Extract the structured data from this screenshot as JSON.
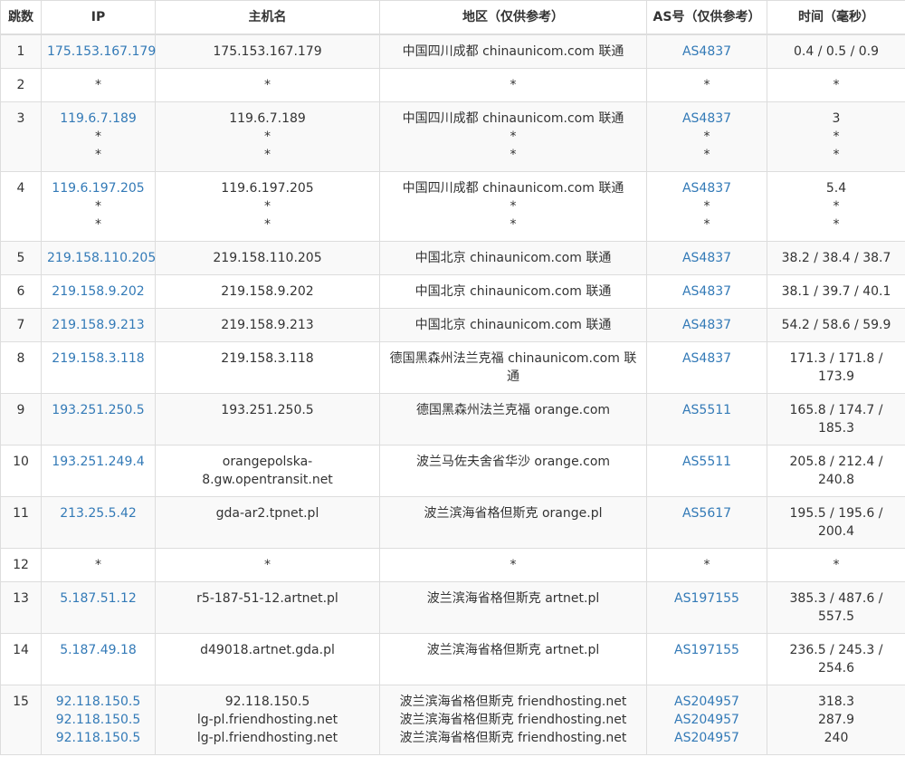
{
  "headers": {
    "hop": "跳数",
    "ip": "IP",
    "host": "主机名",
    "region": "地区（仅供参考）",
    "as": "AS号（仅供参考）",
    "time": "时间（毫秒）"
  },
  "colors": {
    "link": "#337ab7",
    "stripe": "#f9f9f9",
    "border": "#dddddd"
  },
  "rows": [
    {
      "hop": "1",
      "ip": [
        "175.153.167.179"
      ],
      "host": [
        "175.153.167.179"
      ],
      "region": [
        "中国四川成都 chinaunicom.com 联通"
      ],
      "as": [
        "AS4837"
      ],
      "time": [
        "0.4 / 0.5 / 0.9"
      ]
    },
    {
      "hop": "2",
      "ip": [
        "*"
      ],
      "host": [
        "*"
      ],
      "region": [
        "*"
      ],
      "as": [
        "*"
      ],
      "time": [
        "*"
      ]
    },
    {
      "hop": "3",
      "ip": [
        "119.6.7.189",
        "*",
        "*"
      ],
      "host": [
        "119.6.7.189",
        "*",
        "*"
      ],
      "region": [
        "中国四川成都 chinaunicom.com 联通",
        "*",
        "*"
      ],
      "as": [
        "AS4837",
        "*",
        "*"
      ],
      "time": [
        "3",
        "*",
        "*"
      ]
    },
    {
      "hop": "4",
      "ip": [
        "119.6.197.205",
        "*",
        "*"
      ],
      "host": [
        "119.6.197.205",
        "*",
        "*"
      ],
      "region": [
        "中国四川成都 chinaunicom.com 联通",
        "*",
        "*"
      ],
      "as": [
        "AS4837",
        "*",
        "*"
      ],
      "time": [
        "5.4",
        "*",
        "*"
      ]
    },
    {
      "hop": "5",
      "ip": [
        "219.158.110.205"
      ],
      "host": [
        "219.158.110.205"
      ],
      "region": [
        "中国北京 chinaunicom.com 联通"
      ],
      "as": [
        "AS4837"
      ],
      "time": [
        "38.2 / 38.4 / 38.7"
      ]
    },
    {
      "hop": "6",
      "ip": [
        "219.158.9.202"
      ],
      "host": [
        "219.158.9.202"
      ],
      "region": [
        "中国北京 chinaunicom.com 联通"
      ],
      "as": [
        "AS4837"
      ],
      "time": [
        "38.1 / 39.7 / 40.1"
      ]
    },
    {
      "hop": "7",
      "ip": [
        "219.158.9.213"
      ],
      "host": [
        "219.158.9.213"
      ],
      "region": [
        "中国北京 chinaunicom.com 联通"
      ],
      "as": [
        "AS4837"
      ],
      "time": [
        "54.2 / 58.6 / 59.9"
      ]
    },
    {
      "hop": "8",
      "ip": [
        "219.158.3.118"
      ],
      "host": [
        "219.158.3.118"
      ],
      "region": [
        "德国黑森州法兰克福 chinaunicom.com 联通"
      ],
      "as": [
        "AS4837"
      ],
      "time": [
        "171.3 / 171.8 / 173.9"
      ]
    },
    {
      "hop": "9",
      "ip": [
        "193.251.250.5"
      ],
      "host": [
        "193.251.250.5"
      ],
      "region": [
        "德国黑森州法兰克福 orange.com"
      ],
      "as": [
        "AS5511"
      ],
      "time": [
        "165.8 / 174.7 / 185.3"
      ]
    },
    {
      "hop": "10",
      "ip": [
        "193.251.249.4"
      ],
      "host": [
        "orangepolska-8.gw.opentransit.net"
      ],
      "region": [
        "波兰马佐夫舍省华沙 orange.com"
      ],
      "as": [
        "AS5511"
      ],
      "time": [
        "205.8 / 212.4 / 240.8"
      ]
    },
    {
      "hop": "11",
      "ip": [
        "213.25.5.42"
      ],
      "host": [
        "gda-ar2.tpnet.pl"
      ],
      "region": [
        "波兰滨海省格但斯克 orange.pl"
      ],
      "as": [
        "AS5617"
      ],
      "time": [
        "195.5 / 195.6 / 200.4"
      ]
    },
    {
      "hop": "12",
      "ip": [
        "*"
      ],
      "host": [
        "*"
      ],
      "region": [
        "*"
      ],
      "as": [
        "*"
      ],
      "time": [
        "*"
      ]
    },
    {
      "hop": "13",
      "ip": [
        "5.187.51.12"
      ],
      "host": [
        "r5-187-51-12.artnet.pl"
      ],
      "region": [
        "波兰滨海省格但斯克 artnet.pl"
      ],
      "as": [
        "AS197155"
      ],
      "time": [
        "385.3 / 487.6 / 557.5"
      ]
    },
    {
      "hop": "14",
      "ip": [
        "5.187.49.18"
      ],
      "host": [
        "d49018.artnet.gda.pl"
      ],
      "region": [
        "波兰滨海省格但斯克 artnet.pl"
      ],
      "as": [
        "AS197155"
      ],
      "time": [
        "236.5 / 245.3 / 254.6"
      ]
    },
    {
      "hop": "15",
      "ip": [
        "92.118.150.5",
        "92.118.150.5",
        "92.118.150.5"
      ],
      "host": [
        "92.118.150.5",
        "lg-pl.friendhosting.net",
        "lg-pl.friendhosting.net"
      ],
      "region": [
        "波兰滨海省格但斯克 friendhosting.net",
        "波兰滨海省格但斯克 friendhosting.net",
        "波兰滨海省格但斯克 friendhosting.net"
      ],
      "as": [
        "AS204957",
        "AS204957",
        "AS204957"
      ],
      "time": [
        "318.3",
        "287.9",
        "240"
      ]
    }
  ]
}
